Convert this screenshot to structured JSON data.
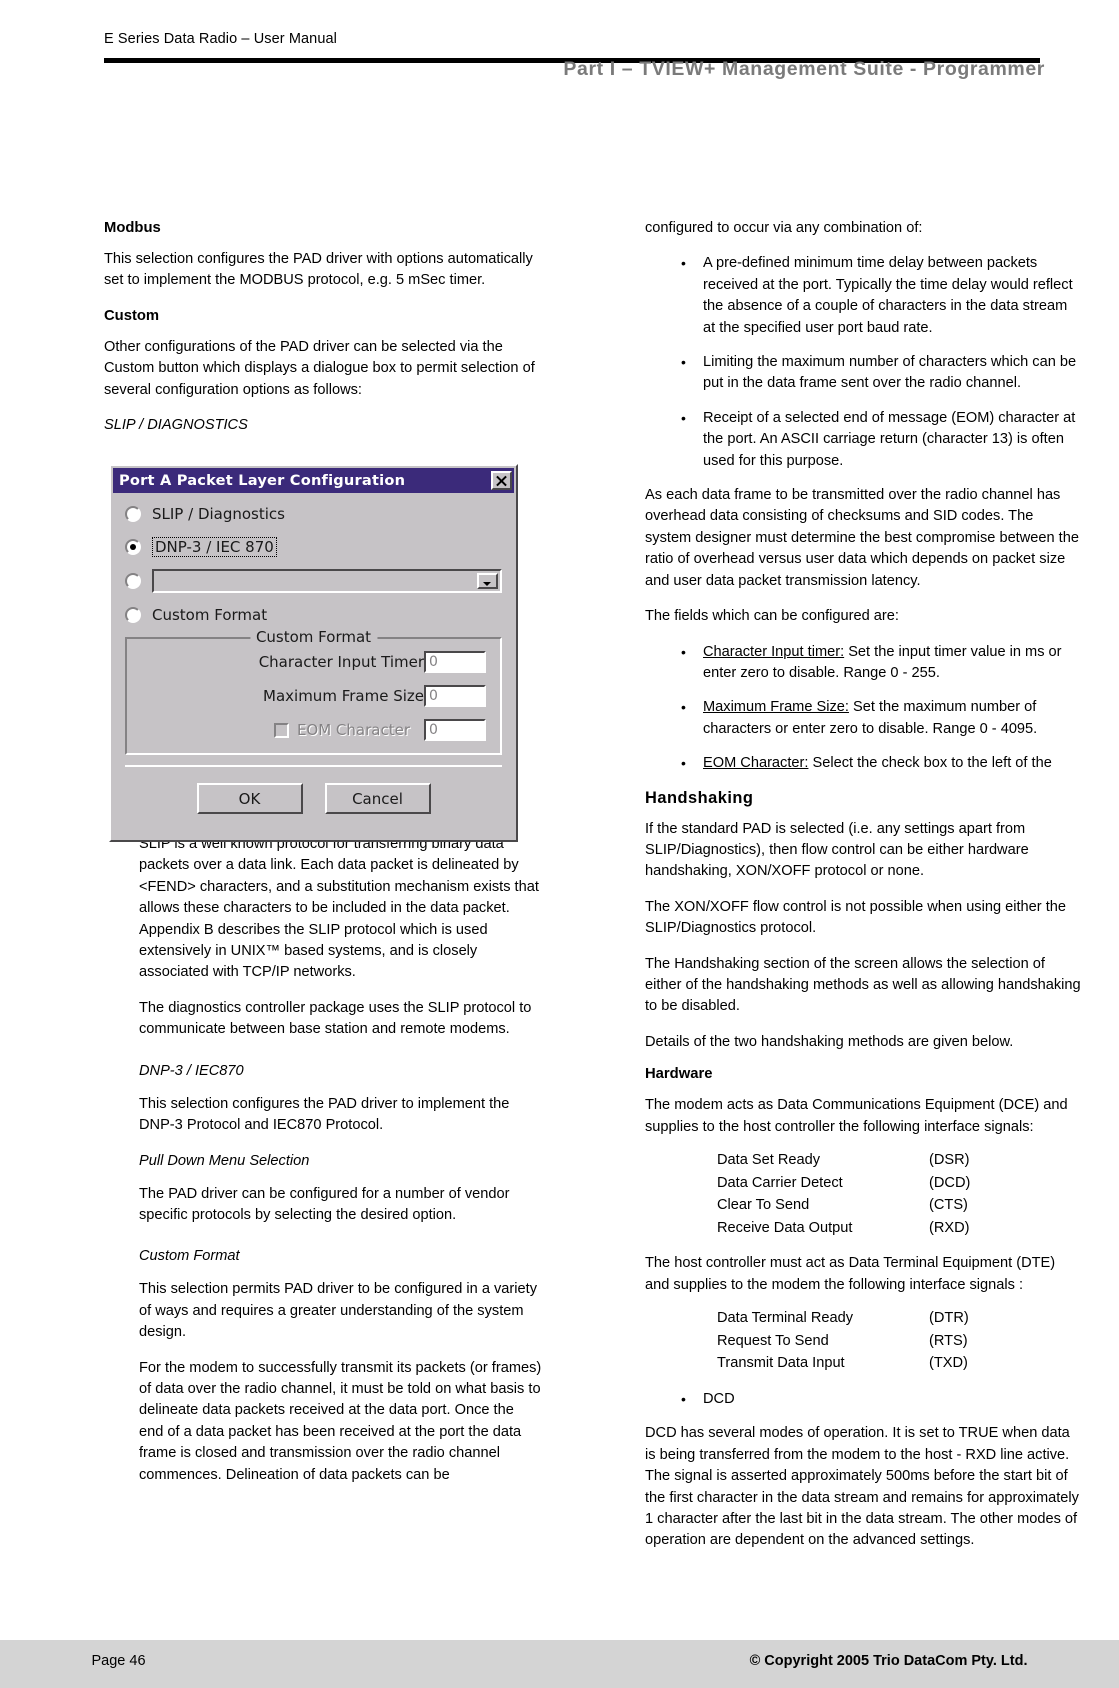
{
  "header": {
    "manual_title": "E Series Data Radio – User Manual",
    "part_title": "Part I – TVIEW+ Management Suite - Programmer"
  },
  "left_column": {
    "modbus_heading": "Modbus",
    "modbus_para": "This selection configures the PAD driver with options automatically set to implement the MODBUS protocol, e.g. 5 mSec timer.",
    "custom_heading": "Custom",
    "custom_para": "Other configurations of the PAD driver can be selected via the Custom button which displays a dialogue box to permit selection of several configuration options as follows:",
    "slip_caption": "SLIP / DIAGNOSTICS",
    "slip_para_1": "SLIP is a well known protocol for transferring binary data packets over a data link. Each data packet is delineated by <FEND> characters, and a substitution mechanism exists that allows these characters to be included in the data packet. Appendix B describes the SLIP protocol which is used extensively in UNIX™ based systems, and is closely associated with TCP/IP networks.",
    "slip_para_2": "The diagnostics controller package uses the SLIP protocol to communicate between base station and remote modems.",
    "dnp_caption": "DNP-3 / IEC870",
    "dnp_para": "This selection configures the PAD driver to implement the DNP-3 Protocol and IEC870 Protocol.",
    "pulldown_caption": "Pull Down Menu Selection",
    "pulldown_para": "The PAD driver can be configured for a number of vendor specific protocols by selecting the desired option.",
    "customformat_caption": "Custom Format",
    "customformat_para_1": "This selection permits PAD driver to be configured in a variety of ways and requires a greater understanding of the system design.",
    "customformat_para_2": "For the modem to successfully transmit its packets (or frames) of data over the radio channel, it must be told on what basis to delineate data packets received at the data port. Once the end of a data packet has been received at the port the data frame is closed and transmission over the radio channel commences. Delineation of data packets can be"
  },
  "dialog": {
    "title": "Port A Packet Layer Configuration",
    "close_icon": "close-icon",
    "options": [
      {
        "label": "SLIP / Diagnostics",
        "selected": false
      },
      {
        "label": "DNP-3 / IEC 870",
        "selected": true
      },
      {
        "label": "",
        "selected": false
      },
      {
        "label": "Custom Format",
        "selected": false
      }
    ],
    "group_legend": "Custom Format",
    "fields": [
      {
        "label": "Character Input Timer",
        "value": "0",
        "disabled": false
      },
      {
        "label": "Maximum Frame Size",
        "value": "0",
        "disabled": false
      },
      {
        "label": "EOM Character",
        "value": "0",
        "disabled": true
      }
    ],
    "ok_label": "OK",
    "cancel_label": "Cancel"
  },
  "right_column": {
    "intro_para": "configured to occur via any combination of:",
    "bullets_1": [
      "A pre-defined minimum time delay between packets received at the port. Typically the time delay would reflect the absence of a couple of characters in the data stream at the specified user port baud rate.",
      "Limiting the maximum number of characters which can be put in the data frame sent over the radio channel.",
      "Receipt of a selected end of message (EOM) character at the port. An ASCII carriage return (character 13) is often used for this purpose."
    ],
    "overhead_para": "As each data frame to be transmitted over the radio channel has overhead data consisting of checksums and SID codes. The system designer must determine the best compromise between the ratio of overhead versus user data which depends on packet size and user data packet transmission latency.",
    "fields_intro": "The fields which can be configured are:",
    "field_bullets": [
      {
        "term": "Character Input timer:",
        "text": " Set the input timer value in ms or enter zero to disable.  Range 0 - 255."
      },
      {
        "term": "Maximum Frame Size:",
        "text": " Set the maximum number of characters or enter zero to disable.  Range 0 - 4095."
      },
      {
        "term": "EOM Character:",
        "text": " Select the check box to the left of the"
      }
    ],
    "handshaking_heading": "Handshaking",
    "handshaking_para_1": "If the standard PAD is selected (i.e. any settings apart from SLIP/Diagnostics), then flow control can be either hardware handshaking, XON/XOFF protocol or none.",
    "handshaking_para_2": "The XON/XOFF flow control is not possible when using either the SLIP/Diagnostics protocol.",
    "handshaking_para_3": "The Handshaking section of the screen allows the selection of either of the handshaking methods as well as allowing handshaking to be disabled.",
    "handshaking_para_4": "Details of the two handshaking methods are given below.",
    "hardware_heading": "Hardware",
    "hardware_para": "The modem acts as Data Communications Equipment (DCE) and supplies to the host controller the following interface signals:",
    "dce_signals": [
      {
        "name": "Data Set Ready",
        "abbr": "(DSR)"
      },
      {
        "name": "Data Carrier Detect",
        "abbr": "(DCD)"
      },
      {
        "name": "Clear To Send",
        "abbr": "(CTS)"
      },
      {
        "name": "Receive Data Output",
        "abbr": "(RXD)"
      }
    ],
    "dte_para": "The host controller must act as Data Terminal Equipment (DTE) and supplies to the modem the following interface signals :",
    "dte_signals": [
      {
        "name": "Data Terminal Ready",
        "abbr": "(DTR)"
      },
      {
        "name": "Request To Send",
        "abbr": "(RTS)"
      },
      {
        "name": "Transmit Data Input",
        "abbr": "(TXD)"
      }
    ],
    "dcd_bullet": "DCD",
    "dcd_para": "DCD has several modes of operation. It is set to TRUE when data is being transferred from the modem to the host - RXD line active.  The signal is asserted approximately 500ms before the start bit of the first character in the data stream and remains for approximately 1 character after the last bit in the data stream. The other modes of operation are dependent on the advanced settings."
  },
  "footer": {
    "page_label": "Page 46",
    "copyright": "© Copyright 2005 Trio DataCom Pty. Ltd."
  }
}
